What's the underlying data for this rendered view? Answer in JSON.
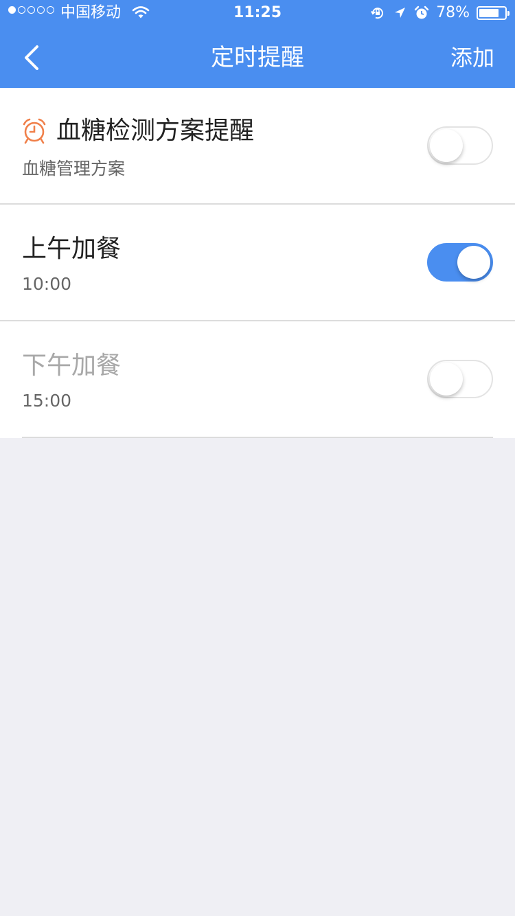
{
  "status_bar": {
    "carrier": "中国移动",
    "time": "11:25",
    "battery_percent": "78%",
    "battery_level": 0.78
  },
  "navbar": {
    "title": "定时提醒",
    "add_label": "添加"
  },
  "reminders": [
    {
      "title": "血糖检测方案提醒",
      "subtitle": "血糖管理方案",
      "enabled": false,
      "icon": "alarm-clock-icon",
      "icon_color": "#f0804a"
    },
    {
      "title": "上午加餐",
      "subtitle": "10:00",
      "enabled": true
    },
    {
      "title": "下午加餐",
      "subtitle": "15:00",
      "enabled": false
    }
  ],
  "colors": {
    "accent": "#4a8ef0",
    "background": "#efeff4"
  }
}
